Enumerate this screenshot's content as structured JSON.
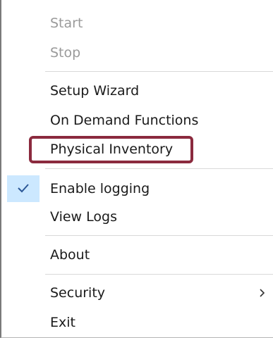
{
  "menu": {
    "items": [
      {
        "id": "start",
        "label": "Start",
        "enabled": false
      },
      {
        "id": "stop",
        "label": "Stop",
        "enabled": false
      },
      {
        "id": "setup_wizard",
        "label": "Setup Wizard",
        "enabled": true
      },
      {
        "id": "on_demand",
        "label": "On Demand Functions",
        "enabled": true
      },
      {
        "id": "physical_inventory",
        "label": "Physical Inventory",
        "enabled": true,
        "highlighted": true
      },
      {
        "id": "enable_logging",
        "label": "Enable logging",
        "enabled": true,
        "checked": true
      },
      {
        "id": "view_logs",
        "label": "View Logs",
        "enabled": true
      },
      {
        "id": "about",
        "label": "About",
        "enabled": true
      },
      {
        "id": "security",
        "label": "Security",
        "enabled": true,
        "submenu": true
      },
      {
        "id": "exit",
        "label": "Exit",
        "enabled": true
      }
    ]
  },
  "icons": {
    "check": "checkmark-icon",
    "submenu_arrow": "chevron-right-icon"
  },
  "colors": {
    "highlight_border": "#8b2a3e",
    "check_gutter": "#cce8ff",
    "check_mark": "#2b5797",
    "disabled_text": "#9a9a9a"
  }
}
